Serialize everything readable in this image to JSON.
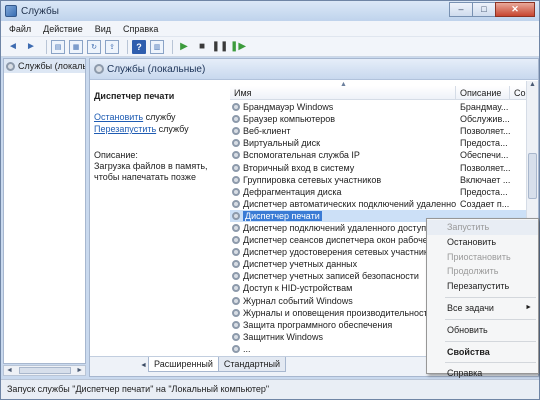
{
  "window": {
    "title": "Службы",
    "minimize": "–",
    "maximize": "□",
    "close": "✕"
  },
  "menu": [
    {
      "label": "Файл",
      "u": "Ф"
    },
    {
      "label": "Действие",
      "u": "Д"
    },
    {
      "label": "Вид",
      "u": "В"
    },
    {
      "label": "Справка",
      "u": "С"
    }
  ],
  "toolbar": {
    "back": "◄",
    "forward": "►",
    "play": "▶",
    "stop": "■",
    "pause": "❚❚",
    "resume": "❚▶",
    "help": "?"
  },
  "tree": {
    "item": "Службы (локальны"
  },
  "main": {
    "header": "Службы (локальные)"
  },
  "detail": {
    "service_name": "Диспетчер печати",
    "stop_link": "Остановить",
    "stop_suffix": " службу",
    "restart_link": "Перезапустить",
    "restart_suffix": " службу",
    "desc_label": "Описание:",
    "desc_text": "Загрузка файлов в память, чтобы напечатать позже"
  },
  "list": {
    "sort_indicator": "▲",
    "columns": {
      "name": "Имя",
      "description": "Описание",
      "state": "Со"
    },
    "rows": [
      {
        "name": "Брандмауэр Windows",
        "description": "Брандмау..."
      },
      {
        "name": "Браузер компьютеров",
        "description": "Обслужив..."
      },
      {
        "name": "Веб-клиент",
        "description": "Позволяет..."
      },
      {
        "name": "Виртуальный диск",
        "description": "Предоста..."
      },
      {
        "name": "Вспомогательная служба IP",
        "description": "Обеспечи..."
      },
      {
        "name": "Вторичный вход в систему",
        "description": "Позволяет..."
      },
      {
        "name": "Группировка сетевых участников",
        "description": "Включает ..."
      },
      {
        "name": "Дефрагментация диска",
        "description": "Предоста..."
      },
      {
        "name": "Диспетчер автоматических подключений удаленного д...",
        "description": "Создает п..."
      },
      {
        "name": "Диспетчер печати",
        "description": "",
        "selected": true
      },
      {
        "name": "Диспетчер подключений удаленного доступа",
        "description": ""
      },
      {
        "name": "Диспетчер сеансов диспетчера окон рабочего сто...",
        "description": ""
      },
      {
        "name": "Диспетчер удостоверения сетевых участников",
        "description": ""
      },
      {
        "name": "Диспетчер учетных данных",
        "description": ""
      },
      {
        "name": "Диспетчер учетных записей безопасности",
        "description": ""
      },
      {
        "name": "Доступ к HID-устройствам",
        "description": ""
      },
      {
        "name": "Журнал событий Windows",
        "description": ""
      },
      {
        "name": "Журналы и оповещения производительности",
        "description": ""
      },
      {
        "name": "Защита программного обеспечения",
        "description": ""
      },
      {
        "name": "Защитник Windows",
        "description": ""
      },
      {
        "name": "...",
        "description": ""
      }
    ]
  },
  "tabs": {
    "arrow": "◄",
    "extended": "Расширенный",
    "standard": "Стандартный"
  },
  "status": "Запуск службы \"Диспетчер печати\" на \"Локальный компьютер\"",
  "context_menu": {
    "start": "Запустить",
    "stop": "Остановить",
    "pause": "Приостановить",
    "resume": "Продолжить",
    "restart": "Перезапустить",
    "all_tasks": "Все задачи",
    "submenu_arrow": "►",
    "refresh": "Обновить",
    "properties": "Свойства",
    "help": "Справка"
  },
  "scroll": {
    "left": "◄",
    "right": "►",
    "up": "▲",
    "down": "▼"
  }
}
